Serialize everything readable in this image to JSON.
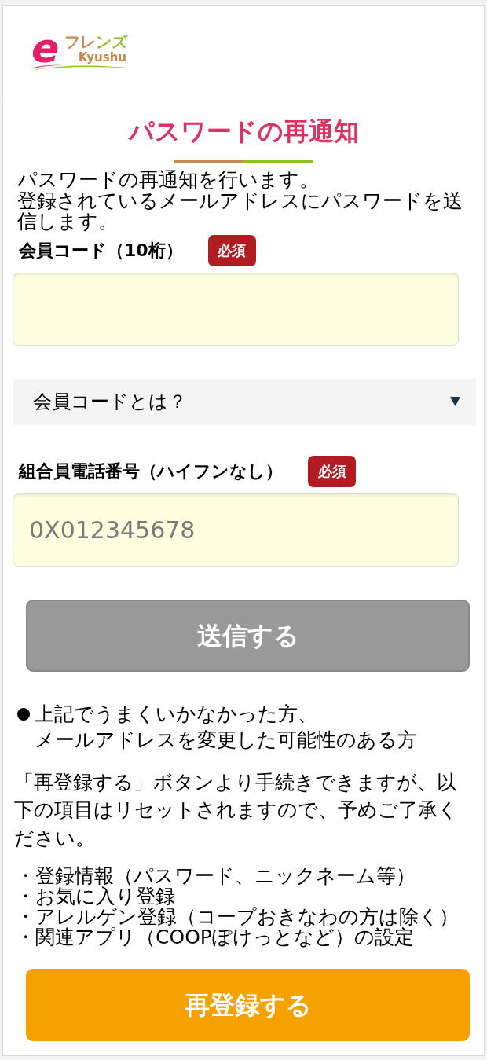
{
  "header": {
    "logo": {
      "mark": "e",
      "name": "フレンズ",
      "region": "Kyushu"
    }
  },
  "title": "パスワードの再通知",
  "description": [
    "パスワードの再通知を行います。",
    "登録されているメールアドレスにパスワードを送信します。"
  ],
  "form": [
    {
      "kind": "field",
      "label": "会員コード（10桁）",
      "badge": "必須"
    },
    {
      "kind": "accordion",
      "label": "会員コードとは？",
      "expanded": false
    },
    {
      "kind": "field",
      "label": "組合員電話番号（ハイフンなし）",
      "badge": "必須",
      "placeholder": "0X012345678"
    }
  ],
  "submit_button": {
    "label": "送信する",
    "disabled": true
  },
  "notice": {
    "lines": [
      "上記でうまくいかなかった方、",
      "メールアドレスを変更した可能性のある方"
    ]
  },
  "reset_note": "「再登録する」ボタンより手続きできますが、以下の項目はリセットされますので、予めご了承ください。",
  "reset_items": [
    "・登録情報（パスワード、ニックネーム等）",
    "・お気に入り登録",
    "・アレルゲン登録（コープおきなわの方は除く）",
    "・関連アプリ（COOPぽけっとなど）の設定"
  ],
  "reregister_button": {
    "label": "再登録する"
  }
}
